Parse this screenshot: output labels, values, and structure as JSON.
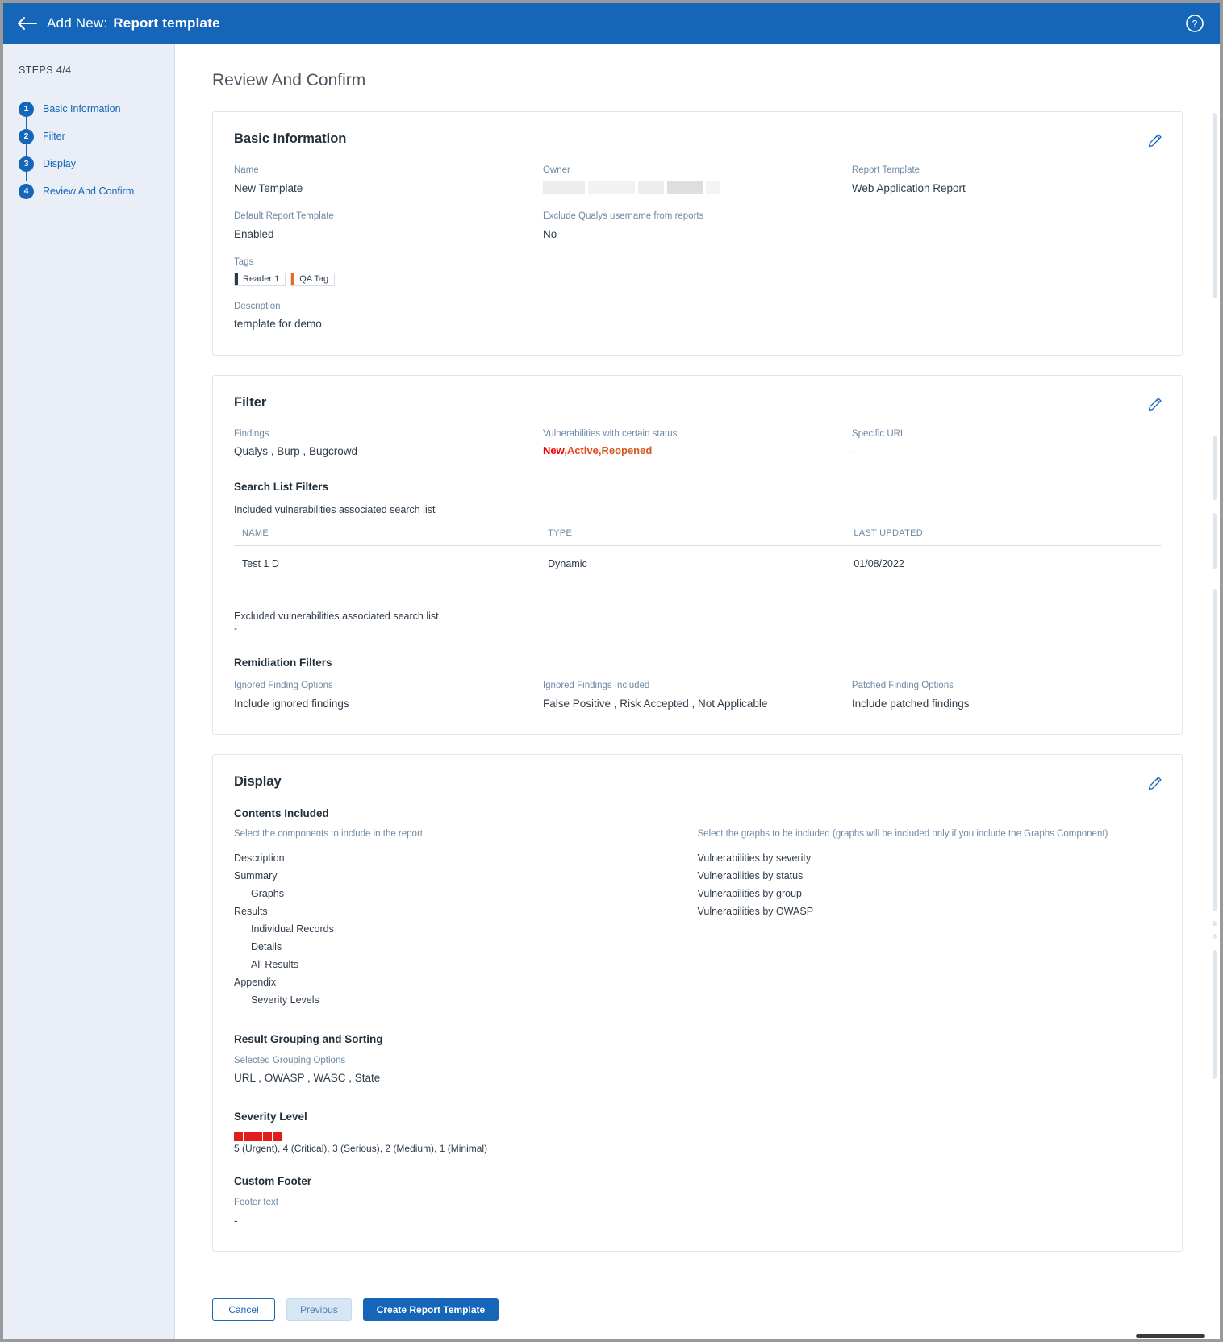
{
  "topbar": {
    "back_icon": "back-arrow-icon",
    "lead": "Add New:",
    "title": "Report template",
    "help_icon": "help-circle-icon",
    "bg_color": "#1565b8"
  },
  "sidebar": {
    "steps_label": "STEPS 4/4",
    "items": [
      {
        "num": "1",
        "label": "Basic Information"
      },
      {
        "num": "2",
        "label": "Filter"
      },
      {
        "num": "3",
        "label": "Display"
      },
      {
        "num": "4",
        "label": "Review And Confirm"
      }
    ]
  },
  "page": {
    "title": "Review And Confirm"
  },
  "basic_information": {
    "card_title": "Basic Information",
    "edit_icon": "pencil-edit-icon",
    "name_label": "Name",
    "name_value": "New Template",
    "owner_label": "Owner",
    "owner_value": "",
    "report_template_label": "Report Template",
    "report_template_value": "Web Application Report",
    "default_template_label": "Default Report Template",
    "default_template_value": "Enabled",
    "exclude_username_label": "Exclude Qualys username from reports",
    "exclude_username_value": "No",
    "tags_label": "Tags",
    "tags": [
      {
        "label": "Reader 1",
        "color": "#2b3a4a"
      },
      {
        "label": "QA Tag",
        "color": "#f26522"
      }
    ],
    "description_label": "Description",
    "description_value": "template for demo"
  },
  "filter": {
    "card_title": "Filter",
    "edit_icon": "pencil-edit-icon",
    "findings_label": "Findings",
    "findings_value": "Qualys , Burp , Bugcrowd",
    "status_label": "Vulnerabilities with certain status",
    "statuses": [
      {
        "label": "New",
        "color": "#f40000"
      },
      {
        "label": ",Active",
        "color": "#e8431a"
      },
      {
        "label": ",Reopened",
        "color": "#d4581c"
      }
    ],
    "specific_url_label": "Specific URL",
    "specific_url_value": "-",
    "search_list_filters_title": "Search List Filters",
    "included_note": "Included vulnerabilities associated search list",
    "table": {
      "columns": [
        "NAME",
        "TYPE",
        "LAST UPDATED"
      ],
      "rows": [
        {
          "name": "Test 1 D",
          "type": "Dynamic",
          "last_updated": "01/08/2022"
        }
      ]
    },
    "excluded_note": "Excluded vulnerabilities associated search list",
    "excluded_value": "-",
    "remediation_title": "Remidiation Filters",
    "ignored_finding_options_label": "Ignored Finding Options",
    "ignored_finding_options_value": "Include ignored findings",
    "ignored_findings_included_label": "Ignored Findings Included",
    "ignored_findings_included_value": "False Positive , Risk Accepted , Not Applicable",
    "patched_finding_options_label": "Patched Finding Options",
    "patched_finding_options_value": "Include patched findings"
  },
  "display": {
    "card_title": "Display",
    "edit_icon": "pencil-edit-icon",
    "contents_title": "Contents Included",
    "components_hint": "Select the components to include in the report",
    "components": [
      {
        "label": "Description",
        "indent": 0
      },
      {
        "label": "Summary",
        "indent": 0
      },
      {
        "label": "Graphs",
        "indent": 1
      },
      {
        "label": "Results",
        "indent": 0
      },
      {
        "label": "Individual Records",
        "indent": 1
      },
      {
        "label": "Details",
        "indent": 1
      },
      {
        "label": "All Results",
        "indent": 1
      },
      {
        "label": "Appendix",
        "indent": 0
      },
      {
        "label": "Severity Levels",
        "indent": 1
      }
    ],
    "graphs_hint": "Select the graphs to be included (graphs will be included only if you include the Graphs Component)",
    "graphs": [
      "Vulnerabilities by severity",
      "Vulnerabilities by status",
      "Vulnerabilities by group",
      "Vulnerabilities by OWASP"
    ],
    "grouping_title": "Result Grouping and Sorting",
    "grouping_label": "Selected Grouping Options",
    "grouping_value": "URL , OWASP , WASC , State",
    "severity_title": "Severity Level",
    "severity_blocks": [
      "#e21b1b",
      "#e21b1b",
      "#e21b1b",
      "#e21b1b",
      "#e21b1b"
    ],
    "severity_caption": "5 (Urgent), 4 (Critical), 3 (Serious), 2 (Medium), 1 (Minimal)",
    "footer_title": "Custom Footer",
    "footer_text_label": "Footer text",
    "footer_text_value": "-"
  },
  "actions": {
    "cancel": "Cancel",
    "previous": "Previous",
    "create": "Create Report Template"
  }
}
